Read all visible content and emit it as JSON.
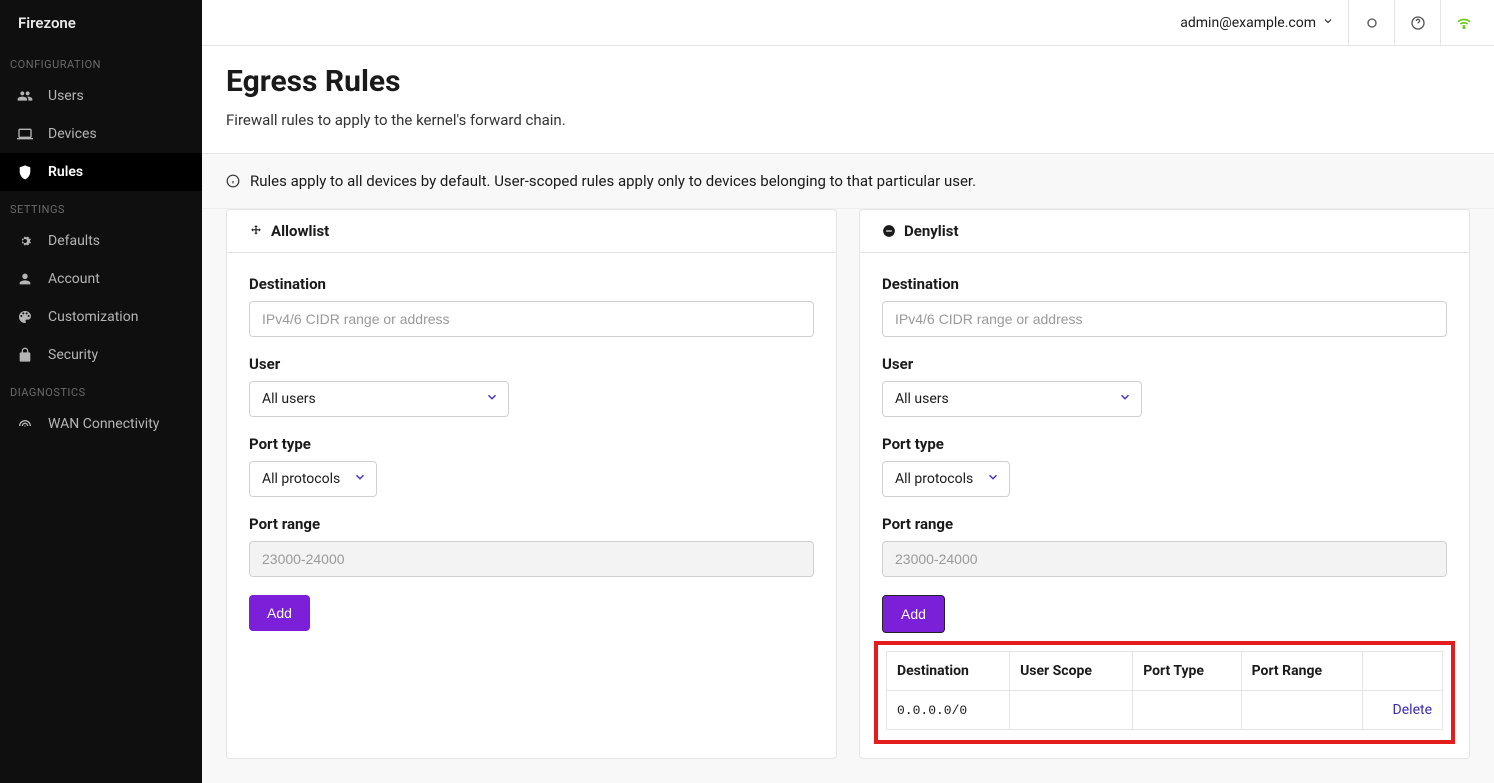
{
  "brand": "Firezone",
  "user_email": "admin@example.com",
  "sidebar": {
    "sections": [
      {
        "label": "CONFIGURATION",
        "items": [
          {
            "label": "Users",
            "icon": "users"
          },
          {
            "label": "Devices",
            "icon": "laptop"
          },
          {
            "label": "Rules",
            "icon": "shield",
            "active": true
          }
        ]
      },
      {
        "label": "SETTINGS",
        "items": [
          {
            "label": "Defaults",
            "icon": "gear"
          },
          {
            "label": "Account",
            "icon": "user"
          },
          {
            "label": "Customization",
            "icon": "palette"
          },
          {
            "label": "Security",
            "icon": "lock"
          }
        ]
      },
      {
        "label": "DIAGNOSTICS",
        "items": [
          {
            "label": "WAN Connectivity",
            "icon": "signal"
          }
        ]
      }
    ]
  },
  "page": {
    "title": "Egress Rules",
    "subtitle": "Firewall rules to apply to the kernel's forward chain.",
    "banner": "Rules apply to all devices by default. User-scoped rules apply only to devices belonging to that particular user."
  },
  "form_labels": {
    "destination": "Destination",
    "destination_placeholder": "IPv4/6 CIDR range or address",
    "user": "User",
    "user_default": "All users",
    "port_type": "Port type",
    "port_type_default": "All protocols",
    "port_range": "Port range",
    "port_range_placeholder": "23000-24000",
    "add": "Add"
  },
  "allowlist": {
    "title": "Allowlist"
  },
  "denylist": {
    "title": "Denylist",
    "table": {
      "headers": [
        "Destination",
        "User Scope",
        "Port Type",
        "Port Range",
        ""
      ],
      "rows": [
        {
          "destination": "0.0.0.0/0",
          "user_scope": "",
          "port_type": "",
          "port_range": "",
          "action": "Delete"
        }
      ]
    }
  }
}
